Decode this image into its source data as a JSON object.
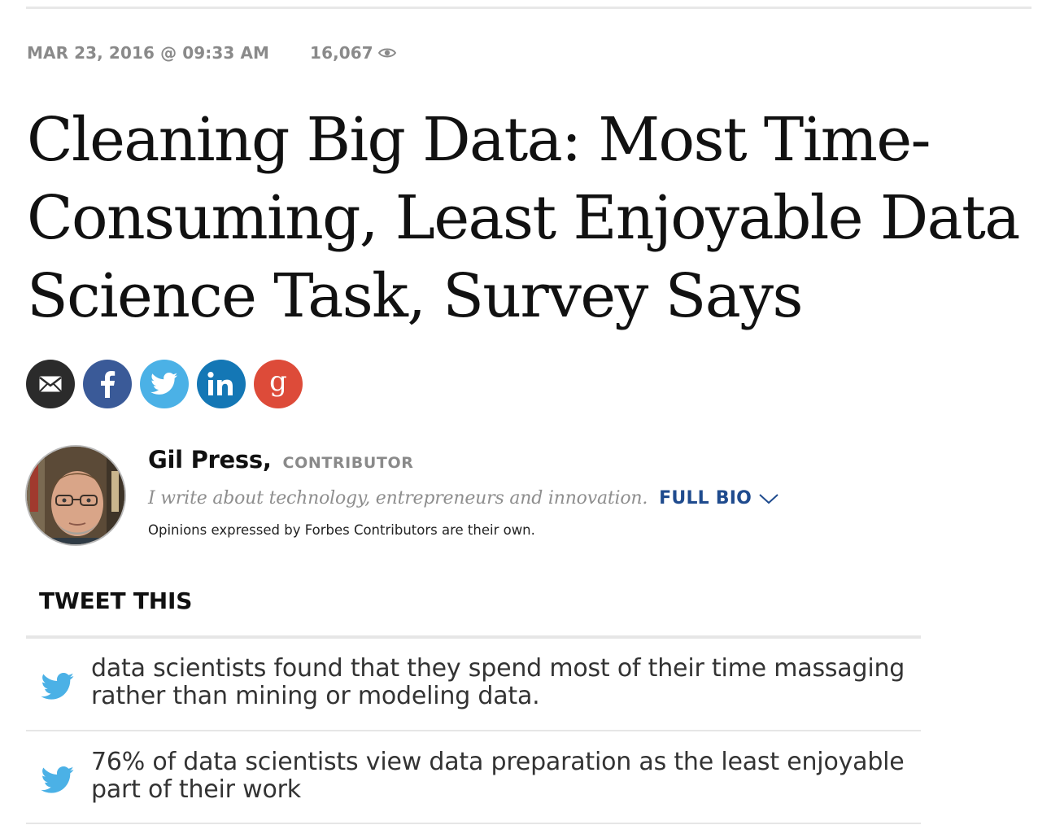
{
  "meta": {
    "date": "MAR 23, 2016 @ 09:33 AM",
    "views": "16,067",
    "views_icon": "eye-icon"
  },
  "article": {
    "title": "Cleaning Big Data: Most Time-Consuming, Least Enjoyable Data Science Task, Survey Says"
  },
  "share": {
    "buttons": [
      {
        "name": "email",
        "icon": "email-icon",
        "color": "#2b2b2b"
      },
      {
        "name": "facebook",
        "icon": "facebook-icon",
        "color": "#3a5a98"
      },
      {
        "name": "twitter",
        "icon": "twitter-icon",
        "color": "#4bb1e6"
      },
      {
        "name": "linkedin",
        "icon": "linkedin-icon",
        "color": "#1477b5"
      },
      {
        "name": "google-plus",
        "icon": "google-plus-icon",
        "color": "#dd4b39"
      }
    ]
  },
  "author": {
    "name": "Gil Press,",
    "role": "CONTRIBUTOR",
    "bio": "I write about technology, entrepreneurs and innovation.",
    "full_bio_label": "FULL BIO",
    "disclaimer": "Opinions expressed by Forbes Contributors are their own."
  },
  "tweet_this": {
    "heading": "TWEET THIS",
    "items": [
      "data scientists found that they spend most of their time massaging rather than mining or modeling data.",
      "76% of data scientists view data preparation as the least enjoyable part of their work"
    ]
  },
  "colors": {
    "link_blue": "#1f4b8e",
    "meta_gray": "#8a8a8a",
    "twitter_blue": "#4bb1e6"
  }
}
